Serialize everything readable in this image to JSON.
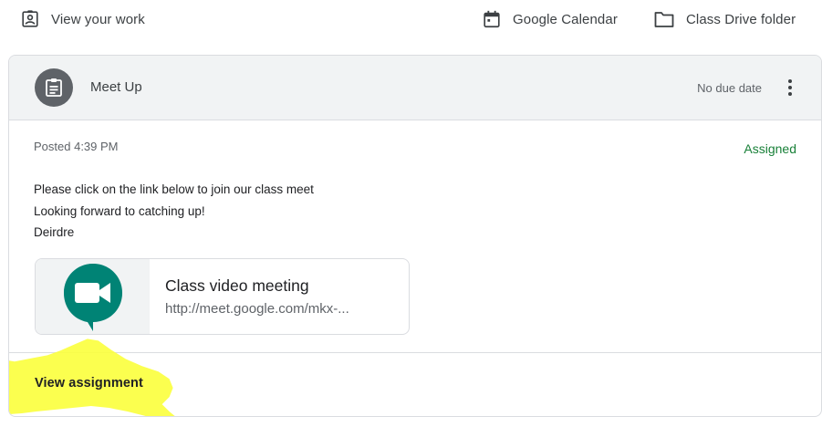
{
  "topbar": {
    "view_work_label": "View your work",
    "calendar_label": "Google Calendar",
    "drive_label": "Class Drive folder"
  },
  "assignment": {
    "title": "Meet Up",
    "due": "No due date",
    "posted": "Posted 4:39 PM",
    "status": "Assigned",
    "body": [
      "Please click on the link below to join our class meet",
      "Looking forward to catching up!",
      "Deirdre"
    ],
    "attachment": {
      "title": "Class video meeting",
      "url": "http://meet.google.com/mkx-..."
    },
    "view_label": "View assignment"
  },
  "icons": {
    "view_work": "assignment-ind-icon",
    "calendar": "calendar-icon",
    "drive": "folder-icon",
    "assignment": "assignment-icon",
    "more": "more-vert-icon",
    "meet": "google-meet-icon"
  },
  "colors": {
    "header_bg": "#f1f3f4",
    "status_green": "#188038",
    "avatar_bg": "#5f6368",
    "highlight_yellow": "#fbff3c",
    "meet_teal": "#00897b"
  }
}
